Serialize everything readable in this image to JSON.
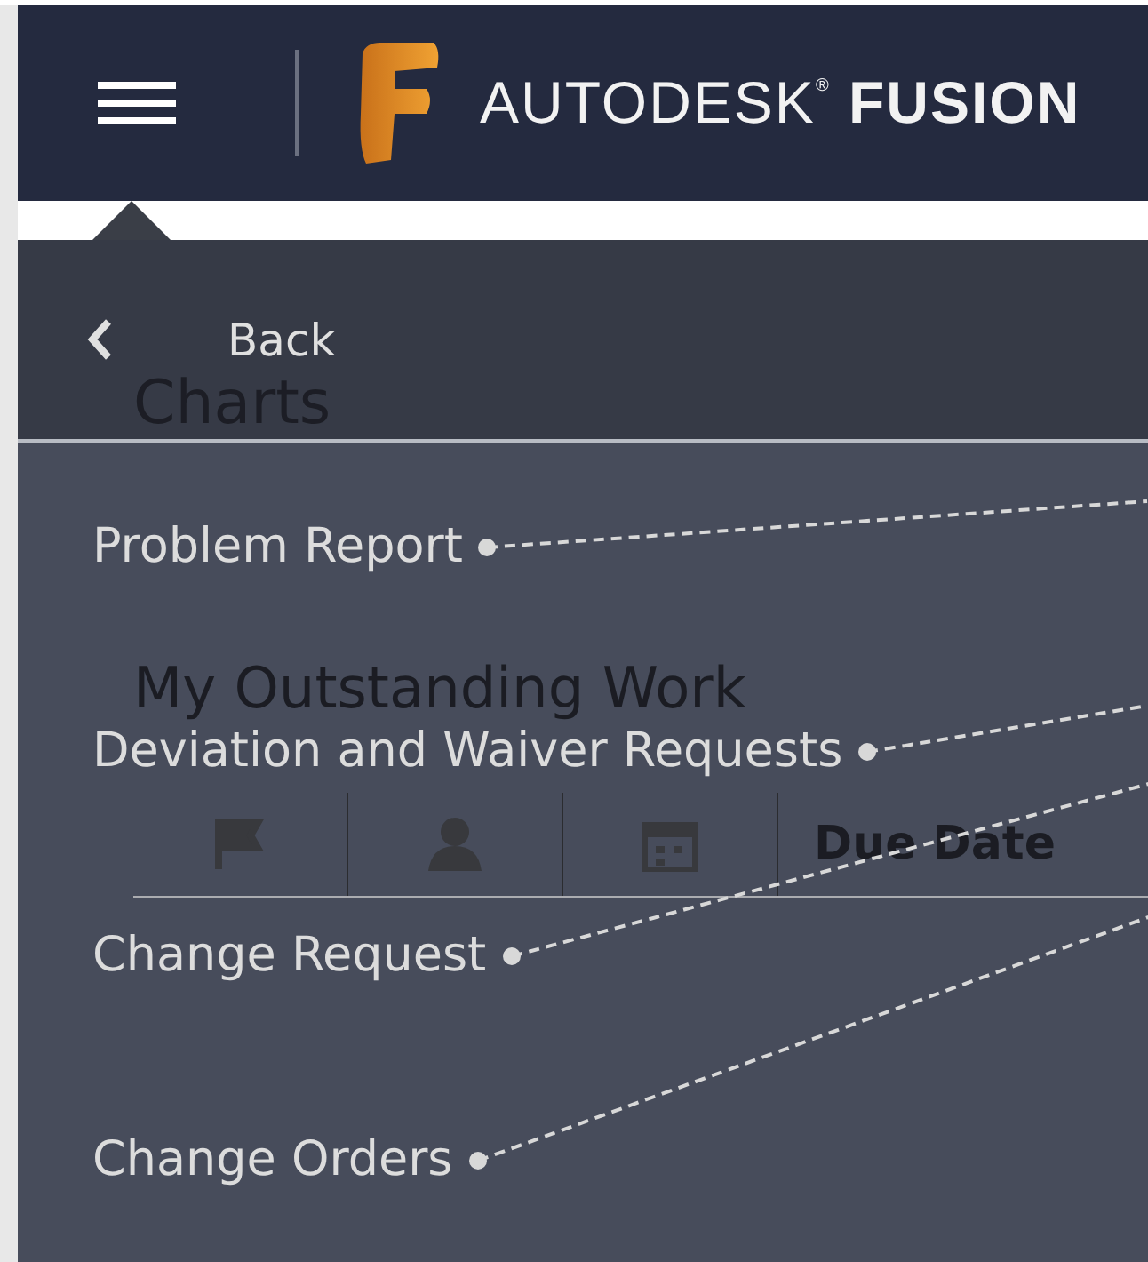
{
  "header": {
    "brand": "AUTODESK$^{®}$ **FUSION**"
  },
  "page": {
    "title": "Charts",
    "section": "My Outstanding Work",
    "columns": [
      {
        "kind": "flag"
      },
      {
        "kind": "person"
      },
      {
        "kind": "calendar"
      },
      {
        "kind": "text",
        "label": "Due Date"
      }
    ]
  },
  "menu": {
    "back": "Back",
    "items": [
      {
        "label": "Problem Report"
      },
      {
        "label": "Deviation and Waiver Requests"
      },
      {
        "label": "Change Request"
      },
      {
        "label": "Change Orders"
      }
    ]
  }
}
